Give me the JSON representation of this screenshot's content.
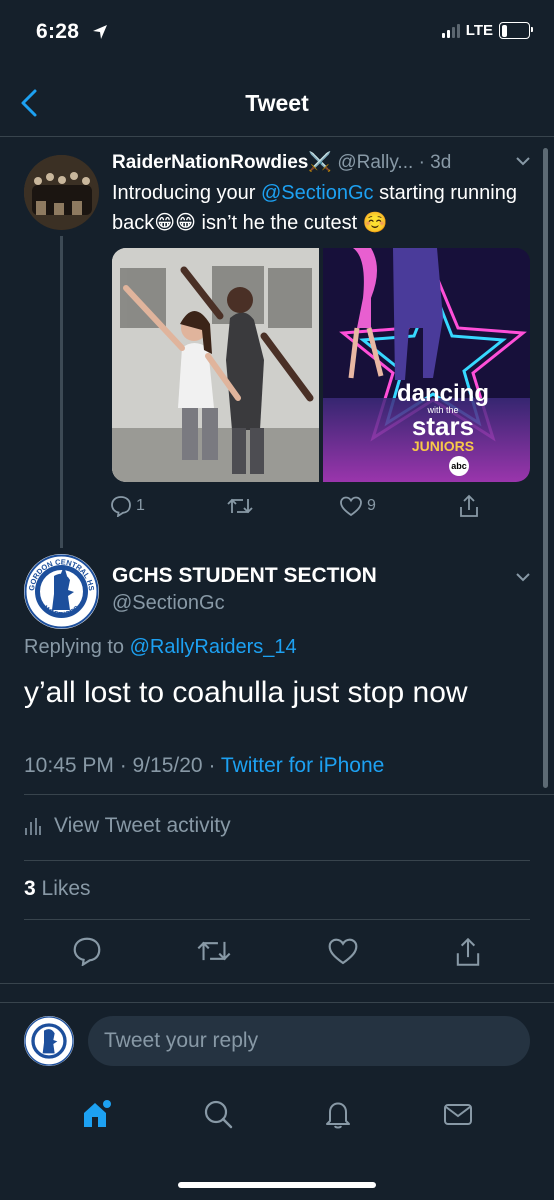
{
  "status_bar": {
    "time": "6:28",
    "network": "LTE"
  },
  "header": {
    "title": "Tweet"
  },
  "parent_tweet": {
    "display_name": "RaiderNationRowdies",
    "name_emoji": "⚔️",
    "handle": "@Rally...",
    "age": "· 3d",
    "text_prefix": "Introducing your ",
    "mention": "@SectionGc",
    "text_suffix": " starting running back😁😁 isn’t he the cutest ☺️",
    "media_logo_line1": "dancing",
    "media_logo_line2": "with the",
    "media_logo_line3": "stars",
    "media_logo_line4": "JUNIORS",
    "media_network": "abc",
    "reply_count": "1",
    "retweet_count": "",
    "like_count": "9"
  },
  "main_tweet": {
    "display_name": "GCHS STUDENT SECTION",
    "handle": "@SectionGc",
    "avatar_text_top": "GORDON CENTRAL HS",
    "avatar_text_bottom": "WARRIORS",
    "replying_label": "Replying to ",
    "replying_to": "@RallyRaiders_14",
    "text": "y’all lost to coahulla just stop now",
    "time_date": "10:45 PM · 9/15/20 · ",
    "source": "Twitter for iPhone",
    "activity_label": "View Tweet activity",
    "likes_count": "3",
    "likes_label": " Likes"
  },
  "reply_bar": {
    "placeholder": "Tweet your reply"
  },
  "colors": {
    "background": "#15202b",
    "accent": "#1da1f2",
    "muted": "#8899a6",
    "divider": "#38444d"
  }
}
